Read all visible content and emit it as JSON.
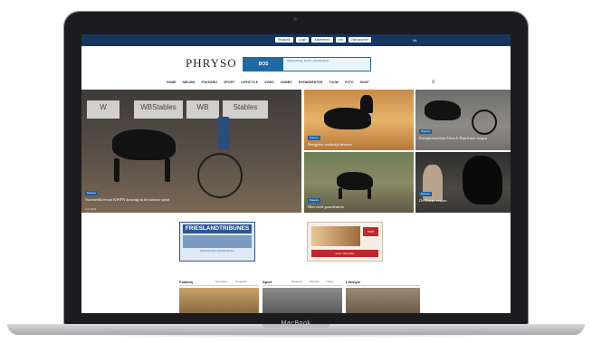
{
  "device": {
    "brand": "MacBook"
  },
  "site": {
    "top_links": [
      "Redactie",
      "Login",
      "Adverteren",
      "Info",
      "Nieuwsbrief"
    ],
    "lang": "NL",
    "logo": "PHRYSO",
    "ad_banner": {
      "brand": "BOS",
      "text": "Stalinrichting, boxen, paardensport"
    },
    "side_logo": "",
    "nav": [
      "HOME",
      "NIEUWS",
      "FOKKERIJ",
      "SPORT",
      "LIFESTYLE",
      "VIDEO",
      "HOBBY",
      "EVENEMENTEN",
      "TOUW",
      "FOTO",
      "SHOP"
    ],
    "featured": [
      {
        "tag": "Nieuws",
        "title": "Voorbeeld eerste KWPN keuring in de nieuwe sport",
        "date": "Juni 2019"
      },
      {
        "tag": "Nieuws",
        "title": "Hengsten wedstrijd nieuws",
        "date": ""
      },
      {
        "tag": "Nieuws",
        "title": "Kampioenschap Friesch Paard met tuigen",
        "date": ""
      },
      {
        "tag": "Nieuws",
        "title": "Hier zoek paardeninfo",
        "date": ""
      },
      {
        "tag": "Nieuws",
        "title": "De Friese veulen",
        "date": ""
      }
    ],
    "ads": [
      {
        "title": "FRIESLANDTRIBUNES",
        "sub": "Hiervoor bos verhuurservice"
      },
      {
        "logo": "NMO",
        "button": "meer informatie"
      }
    ],
    "sections": [
      {
        "title": "Fokkerij",
        "subs": [
          "Keuringen",
          "Hengsten"
        ]
      },
      {
        "title": "Sport",
        "subs": [
          "Dressuur",
          "Mennen",
          "Tuigen"
        ]
      },
      {
        "title": "Lifestyle",
        "subs": []
      }
    ],
    "colors": {
      "primary": "#17365f",
      "accent": "#1f5fa3",
      "ad_red": "#c1272d"
    }
  }
}
